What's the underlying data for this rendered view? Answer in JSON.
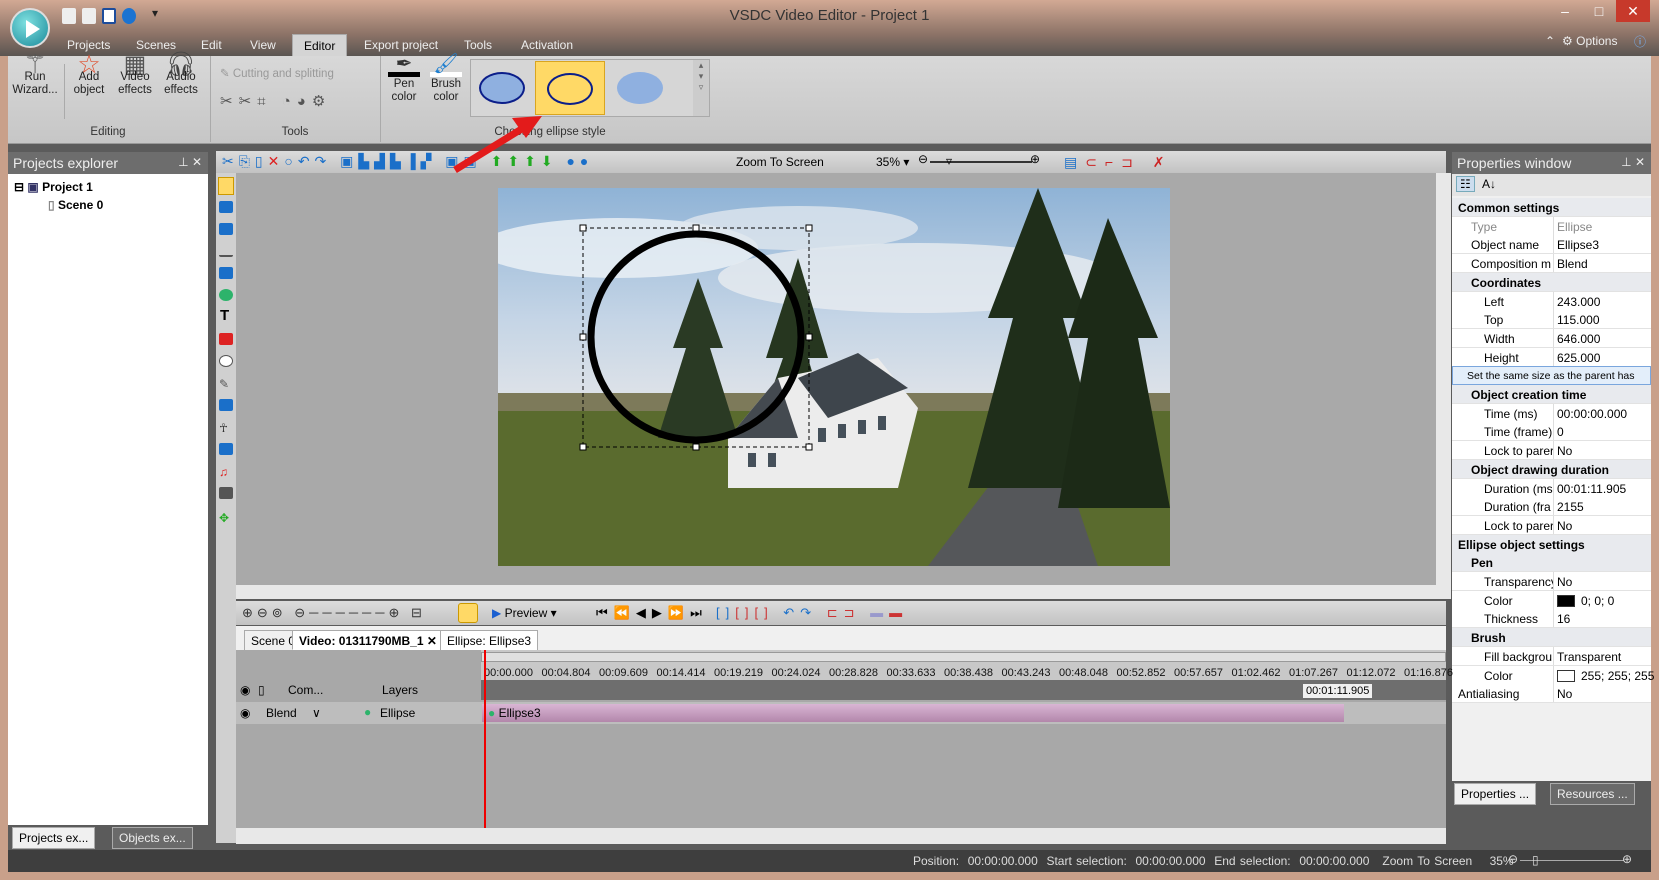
{
  "window": {
    "title": "VSDC Video Editor - Project 1",
    "options": "Options"
  },
  "menu": [
    "Projects",
    "Scenes",
    "Edit",
    "View",
    "Editor",
    "Export project",
    "Tools",
    "Activation"
  ],
  "menu_active": "Editor",
  "ribbon": {
    "editing": {
      "label": "Editing",
      "buttons": [
        "Run Wizard...",
        "Add object",
        "Video effects",
        "Audio effects"
      ]
    },
    "tools": {
      "label": "Tools",
      "cutting": "Cutting and splitting"
    },
    "style": {
      "label": "Choosing ellipse style",
      "pen": "Pen color",
      "brush": "Brush color"
    }
  },
  "projects_explorer": {
    "title": "Projects explorer",
    "project": "Project 1",
    "scene": "Scene 0",
    "tabs": [
      "Projects ex...",
      "Objects ex..."
    ]
  },
  "toolbar": {
    "zoom_mode": "Zoom To Screen",
    "zoom": "35%"
  },
  "properties": {
    "title": "Properties window",
    "rows": [
      {
        "k": "Common settings",
        "sec": true,
        "lvl": 0
      },
      {
        "k": "Type",
        "v": "Ellipse",
        "lvl": 1,
        "dim": true
      },
      {
        "k": "Object name",
        "v": "Ellipse3",
        "lvl": 1
      },
      {
        "k": "Composition m",
        "v": "Blend",
        "lvl": 1
      },
      {
        "k": "Coordinates",
        "sec": true,
        "lvl": 1
      },
      {
        "k": "Left",
        "v": "243.000",
        "lvl": 2
      },
      {
        "k": "Top",
        "v": "115.000",
        "lvl": 2
      },
      {
        "k": "Width",
        "v": "646.000",
        "lvl": 2
      },
      {
        "k": "Height",
        "v": "625.000",
        "lvl": 2
      },
      {
        "k": "Set the same size as the parent has",
        "btn": true
      },
      {
        "k": "Object creation time",
        "sec": true,
        "lvl": 1
      },
      {
        "k": "Time (ms)",
        "v": "00:00:00.000",
        "lvl": 2
      },
      {
        "k": "Time (frame)",
        "v": "0",
        "lvl": 2
      },
      {
        "k": "Lock to parer",
        "v": "No",
        "lvl": 2
      },
      {
        "k": "Object drawing duration",
        "sec": true,
        "lvl": 1
      },
      {
        "k": "Duration (ms",
        "v": "00:01:11.905",
        "lvl": 2
      },
      {
        "k": "Duration (fra",
        "v": "2155",
        "lvl": 2
      },
      {
        "k": "Lock to parer",
        "v": "No",
        "lvl": 2
      },
      {
        "k": "Ellipse object settings",
        "sec": true,
        "lvl": 0
      },
      {
        "k": "Pen",
        "sec": true,
        "lvl": 1
      },
      {
        "k": "Transparency",
        "v": "No",
        "lvl": 2
      },
      {
        "k": "Color",
        "v": "0; 0; 0",
        "lvl": 2,
        "swatch": "#000000"
      },
      {
        "k": "Thickness",
        "v": "16",
        "lvl": 2
      },
      {
        "k": "Brush",
        "sec": true,
        "lvl": 1
      },
      {
        "k": "Fill backgrou",
        "v": "Transparent",
        "lvl": 2
      },
      {
        "k": "Color",
        "v": "255; 255; 255",
        "lvl": 2,
        "swatch": "#ffffff"
      },
      {
        "k": "Antialiasing",
        "v": "No",
        "lvl": 0
      }
    ],
    "tabs": [
      "Properties ...",
      "Resources ..."
    ]
  },
  "timeline": {
    "preview": "Preview",
    "tabs": [
      "Scene 0",
      "Video: 01311790MB_1",
      "Ellipse: Ellipse3"
    ],
    "ticks": [
      "00:00.000",
      "00:04.804",
      "00:09.609",
      "00:14.414",
      "00:19.219",
      "00:24.024",
      "00:28.828",
      "00:33.633",
      "00:38.438",
      "00:43.243",
      "00:48.048",
      "00:52.852",
      "00:57.657",
      "01:02.462",
      "01:07.267",
      "01:12.072",
      "01:16.876"
    ],
    "end_marker": "00:01:11.905",
    "headers": {
      "com": "Com...",
      "layers": "Layers"
    },
    "layer": {
      "blend": "Blend",
      "name": "Ellipse",
      "clip": "Ellipse3"
    }
  },
  "status": {
    "position_label": "Position:",
    "position": "00:00:00.000",
    "start_label": "Start selection:",
    "start": "00:00:00.000",
    "end_label": "End selection:",
    "end": "00:00:00.000",
    "zoom_mode": "Zoom To Screen",
    "zoom": "35%"
  },
  "colors": {
    "highlight": "#e31b1b",
    "selected_style": "#ffd966",
    "clip": "#c79ac0"
  }
}
